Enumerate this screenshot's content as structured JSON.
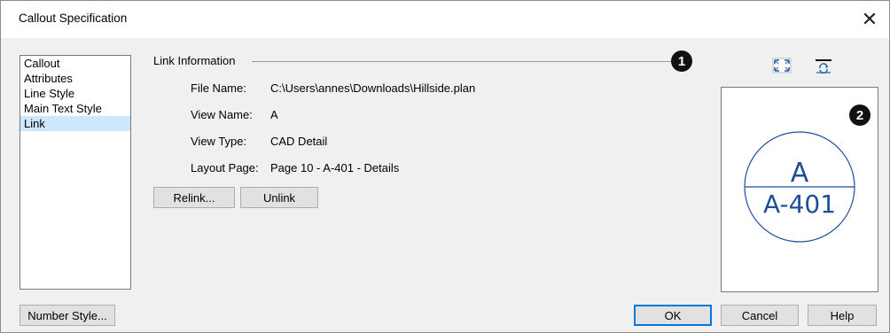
{
  "window": {
    "title": "Callout Specification",
    "close_glyph": "✕"
  },
  "sidebar": {
    "items": [
      {
        "label": "Callout"
      },
      {
        "label": "Attributes"
      },
      {
        "label": "Line Style"
      },
      {
        "label": "Main Text Style"
      },
      {
        "label": "Link",
        "selected": true
      }
    ]
  },
  "link_info": {
    "group_label": "Link Information",
    "file_name_label": "File Name:",
    "file_name_value": "C:\\Users\\annes\\Downloads\\Hillside.plan",
    "view_name_label": "View Name:",
    "view_name_value": "A",
    "view_type_label": "View Type:",
    "view_type_value": "CAD Detail",
    "layout_page_label": "Layout Page:",
    "layout_page_value": "Page 10 - A-401 - Details",
    "relink_label": "Relink...",
    "unlink_label": "Unlink"
  },
  "callouts": {
    "one": "1",
    "two": "2"
  },
  "preview": {
    "top_text": "A",
    "bottom_text": "A-401"
  },
  "toolbar": {
    "fit_icon": "zoom-extents-icon",
    "swap_icon": "refresh-view-icon"
  },
  "footer": {
    "number_style_label": "Number Style...",
    "ok_label": "OK",
    "cancel_label": "Cancel",
    "help_label": "Help"
  },
  "colors": {
    "selection": "#cce8ff",
    "accent": "#0078d7",
    "preview_ink": "#1f4e9c"
  }
}
